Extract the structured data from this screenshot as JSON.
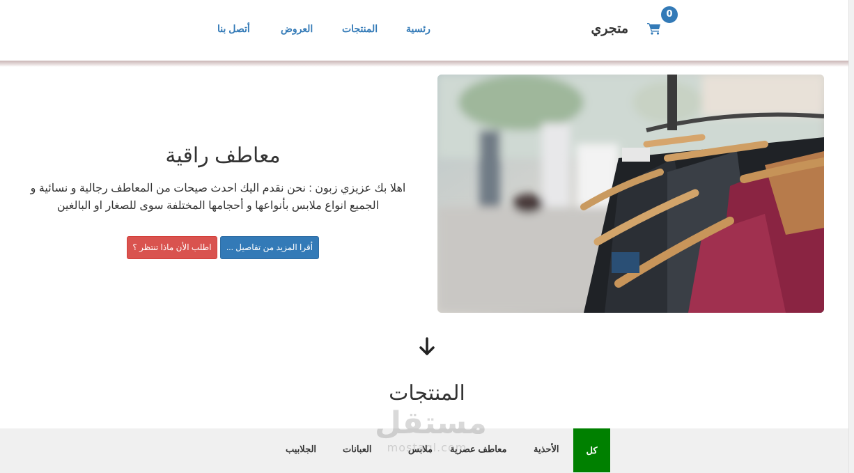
{
  "header": {
    "brand": "متجري",
    "cart_count": "0",
    "nav": [
      "رئسية",
      "المنتجات",
      "العروض",
      "أتصل بنا"
    ]
  },
  "hero": {
    "title": "معاطف راقية",
    "text": "اهلا بك عزيزي زبون : نحن نقدم اليك احدث صيحات من المعاطف رجالية و نسائية و الجميع انواع ملابس بأنواعها و أحجامها المختلفة سوى للصغار او البالغين",
    "read_more": "أقرا المزيد من تفاصيل ...",
    "order_now": "اطلب الأن ماذا تنتظر ؟"
  },
  "products": {
    "title": "المنتجات",
    "filters": [
      "كل",
      "الأحذية",
      "معاطف عصرية",
      "ملابس",
      "العبانات",
      "الجلابيب"
    ],
    "active_filter": "كل"
  },
  "watermark": {
    "main": "مستقل",
    "sub": "mostaql.com"
  },
  "colors": {
    "primary": "#337ab7",
    "danger": "#d9534f",
    "active_filter": "#008000"
  }
}
